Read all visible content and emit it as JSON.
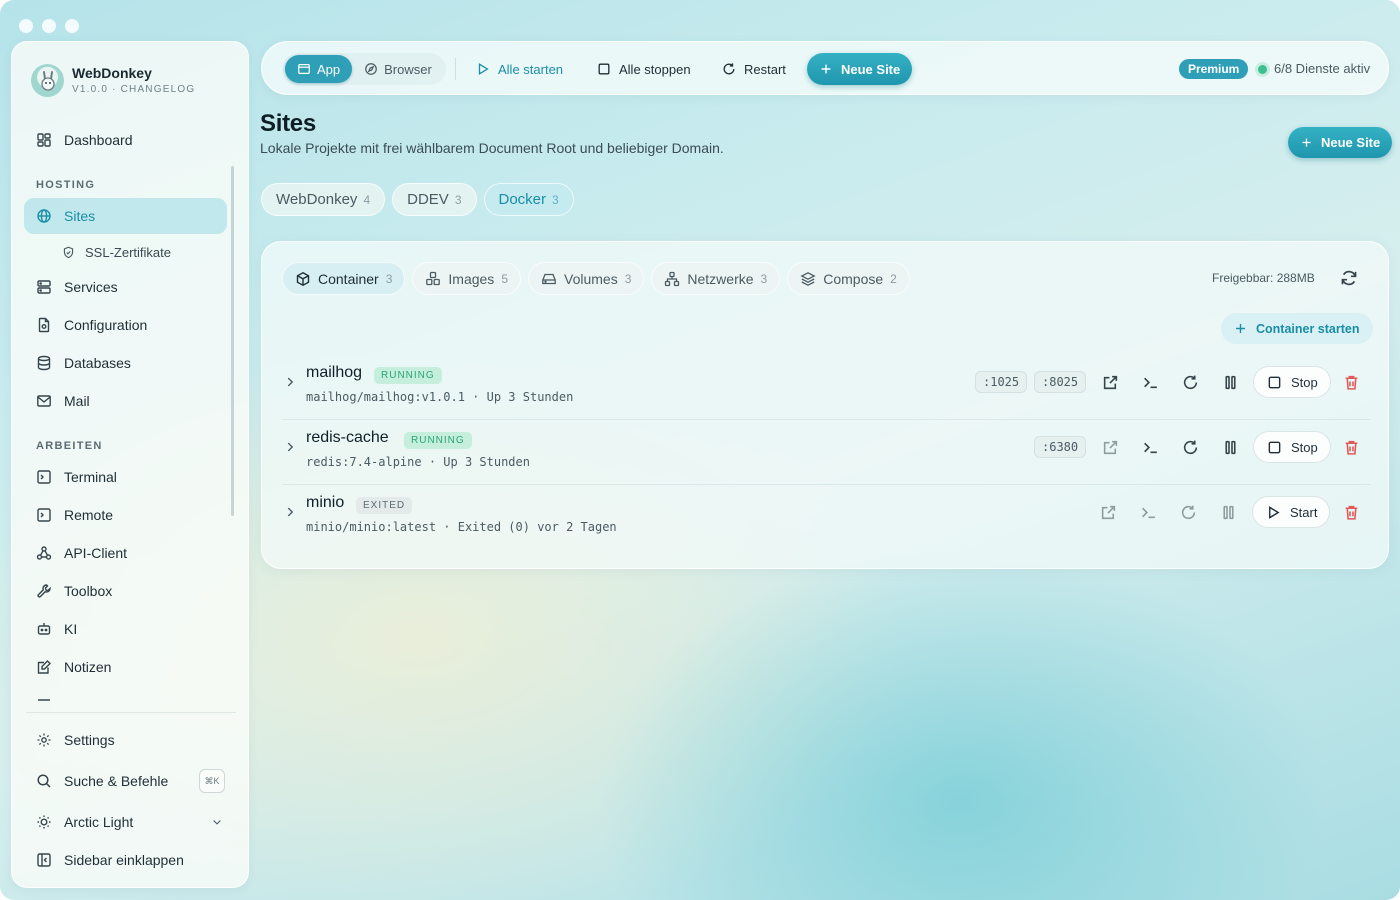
{
  "window": {
    "controls": [
      "close",
      "minimize",
      "maximize"
    ]
  },
  "brand": {
    "name": "WebDonkey",
    "version": "V1.0.0 · CHANGELOG",
    "logo_icon": "donkey-icon"
  },
  "sidebar": {
    "dashboard": "Dashboard",
    "section_hosting": "HOSTING",
    "sites": "Sites",
    "ssl": "SSL-Zertifikate",
    "services": "Services",
    "configuration": "Configuration",
    "databases": "Databases",
    "mail": "Mail",
    "section_arbeiten": "ARBEITEN",
    "terminal": "Terminal",
    "remote": "Remote",
    "api_client": "API-Client",
    "toolbox": "Toolbox",
    "ki": "KI",
    "notizen": "Notizen",
    "settings": "Settings",
    "search": "Suche & Befehle",
    "search_shortcut": "⌘K",
    "theme": "Arctic Light",
    "collapse": "Sidebar einklappen"
  },
  "toolbar": {
    "mode_app": "App",
    "mode_browser": "Browser",
    "start_all": "Alle starten",
    "stop_all": "Alle stoppen",
    "restart": "Restart",
    "new_site": "Neue Site",
    "premium": "Premium",
    "services_status": "6/8 Dienste aktiv"
  },
  "page": {
    "title": "Sites",
    "subtitle": "Lokale Projekte mit frei wählbarem Document Root und beliebiger Domain.",
    "new_site": "Neue Site"
  },
  "site_tabs": [
    {
      "label": "WebDonkey",
      "count": "4"
    },
    {
      "label": "DDEV",
      "count": "3"
    },
    {
      "label": "Docker",
      "count": "3"
    }
  ],
  "docker_tabs": [
    {
      "label": "Container",
      "count": "3"
    },
    {
      "label": "Images",
      "count": "5"
    },
    {
      "label": "Volumes",
      "count": "3"
    },
    {
      "label": "Netzwerke",
      "count": "3"
    },
    {
      "label": "Compose",
      "count": "2"
    }
  ],
  "freigabe": "Freigebbar: 288MB",
  "container_start": "Container starten",
  "containers": [
    {
      "name": "mailhog",
      "status": "RUNNING",
      "meta": "mailhog/mailhog:v1.0.1 · Up 3 Stunden",
      "ports": [
        ":1025",
        ":8025"
      ],
      "action": "Stop"
    },
    {
      "name": "redis-cache",
      "status": "RUNNING",
      "meta": "redis:7.4-alpine · Up 3 Stunden",
      "ports": [
        ":6380"
      ],
      "action": "Stop"
    },
    {
      "name": "minio",
      "status": "EXITED",
      "meta": "minio/minio:latest · Exited (0) vor 2 Tagen",
      "ports": [],
      "action": "Start"
    }
  ],
  "colors": {
    "accent": "#2e9fb6",
    "running": "#2aa574",
    "danger": "#e05a5a",
    "status_dot": "#3cc08f"
  }
}
